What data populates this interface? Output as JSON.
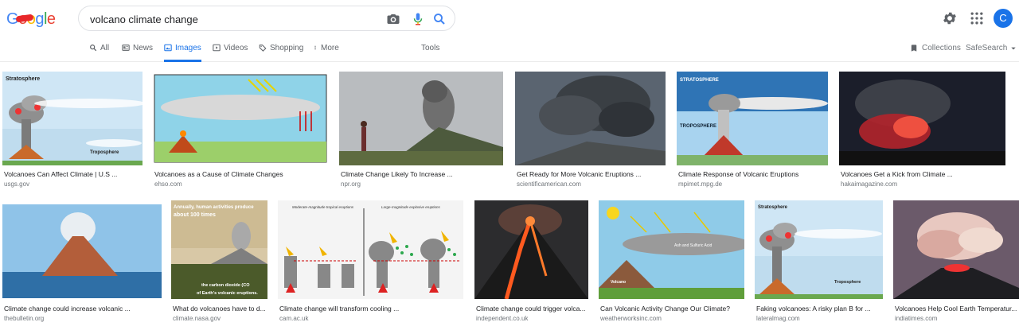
{
  "search": {
    "query": "volcano climate change"
  },
  "tabs": [
    {
      "label": "All",
      "icon": "search-icon"
    },
    {
      "label": "News",
      "icon": "news-icon"
    },
    {
      "label": "Images",
      "icon": "image-icon"
    },
    {
      "label": "Videos",
      "icon": "video-icon"
    },
    {
      "label": "Shopping",
      "icon": "tag-icon"
    },
    {
      "label": "More",
      "icon": "more-icon"
    }
  ],
  "tools_label": "Tools",
  "collections_label": "Collections",
  "safesearch_label": "SafeSearch",
  "avatar_letter": "C",
  "colors": {
    "accent": "#1a73e8",
    "text": "#202124",
    "muted": "#70757a"
  },
  "results": [
    {
      "caption": "Volcanoes Can Affect Climate | U.S ...",
      "domain": "usgs.gov"
    },
    {
      "caption": "Volcanoes as a Cause of Climate Changes",
      "domain": "ehso.com"
    },
    {
      "caption": "Climate Change Likely To Increase ...",
      "domain": "npr.org"
    },
    {
      "caption": "Get Ready for More Volcanic Eruptions ...",
      "domain": "scientificamerican.com"
    },
    {
      "caption": "Climate Response of Volcanic Eruptions",
      "domain": "mpimet.mpg.de"
    },
    {
      "caption": "Volcanoes Get a Kick from Climate ...",
      "domain": "hakaimagazine.com"
    },
    {
      "caption": "Climate change could increase volcanic ...",
      "domain": "thebulletin.org"
    },
    {
      "caption": "What do volcanoes have to d...",
      "domain": "climate.nasa.gov"
    },
    {
      "caption": "Climate change will transform cooling ...",
      "domain": "cam.ac.uk"
    },
    {
      "caption": "Climate change could trigger volca...",
      "domain": "independent.co.uk"
    },
    {
      "caption": "Can Volcanic Activity Change Our Climate?",
      "domain": "weatherworksinc.com"
    },
    {
      "caption": "Faking volcanoes: A risky plan B for ...",
      "domain": "lateralmag.com"
    },
    {
      "caption": "Volcanoes Help Cool Earth Temperatur...",
      "domain": "indiatimes.com"
    }
  ],
  "thumb_text": {
    "stratosphere": "Stratosphere",
    "troposphere": "Troposphere",
    "STRATOSPHERE": "STRATOSPHERE",
    "TROPOSPHERE": "TROPOSPHERE",
    "nasa_line1": "Annually, human activities produce",
    "nasa_line2": "about 100 times",
    "nasa_line3": "the carbon dioxide (CO",
    "nasa_line4": "of Earth's volcanic eruptions.",
    "cam_left": "Moderate-magnitude tropical eruptions",
    "cam_right": "Large-magnitude explosive eruptions",
    "ash": "Ash and Sulfuric Acid",
    "volcano": "Volcano"
  }
}
